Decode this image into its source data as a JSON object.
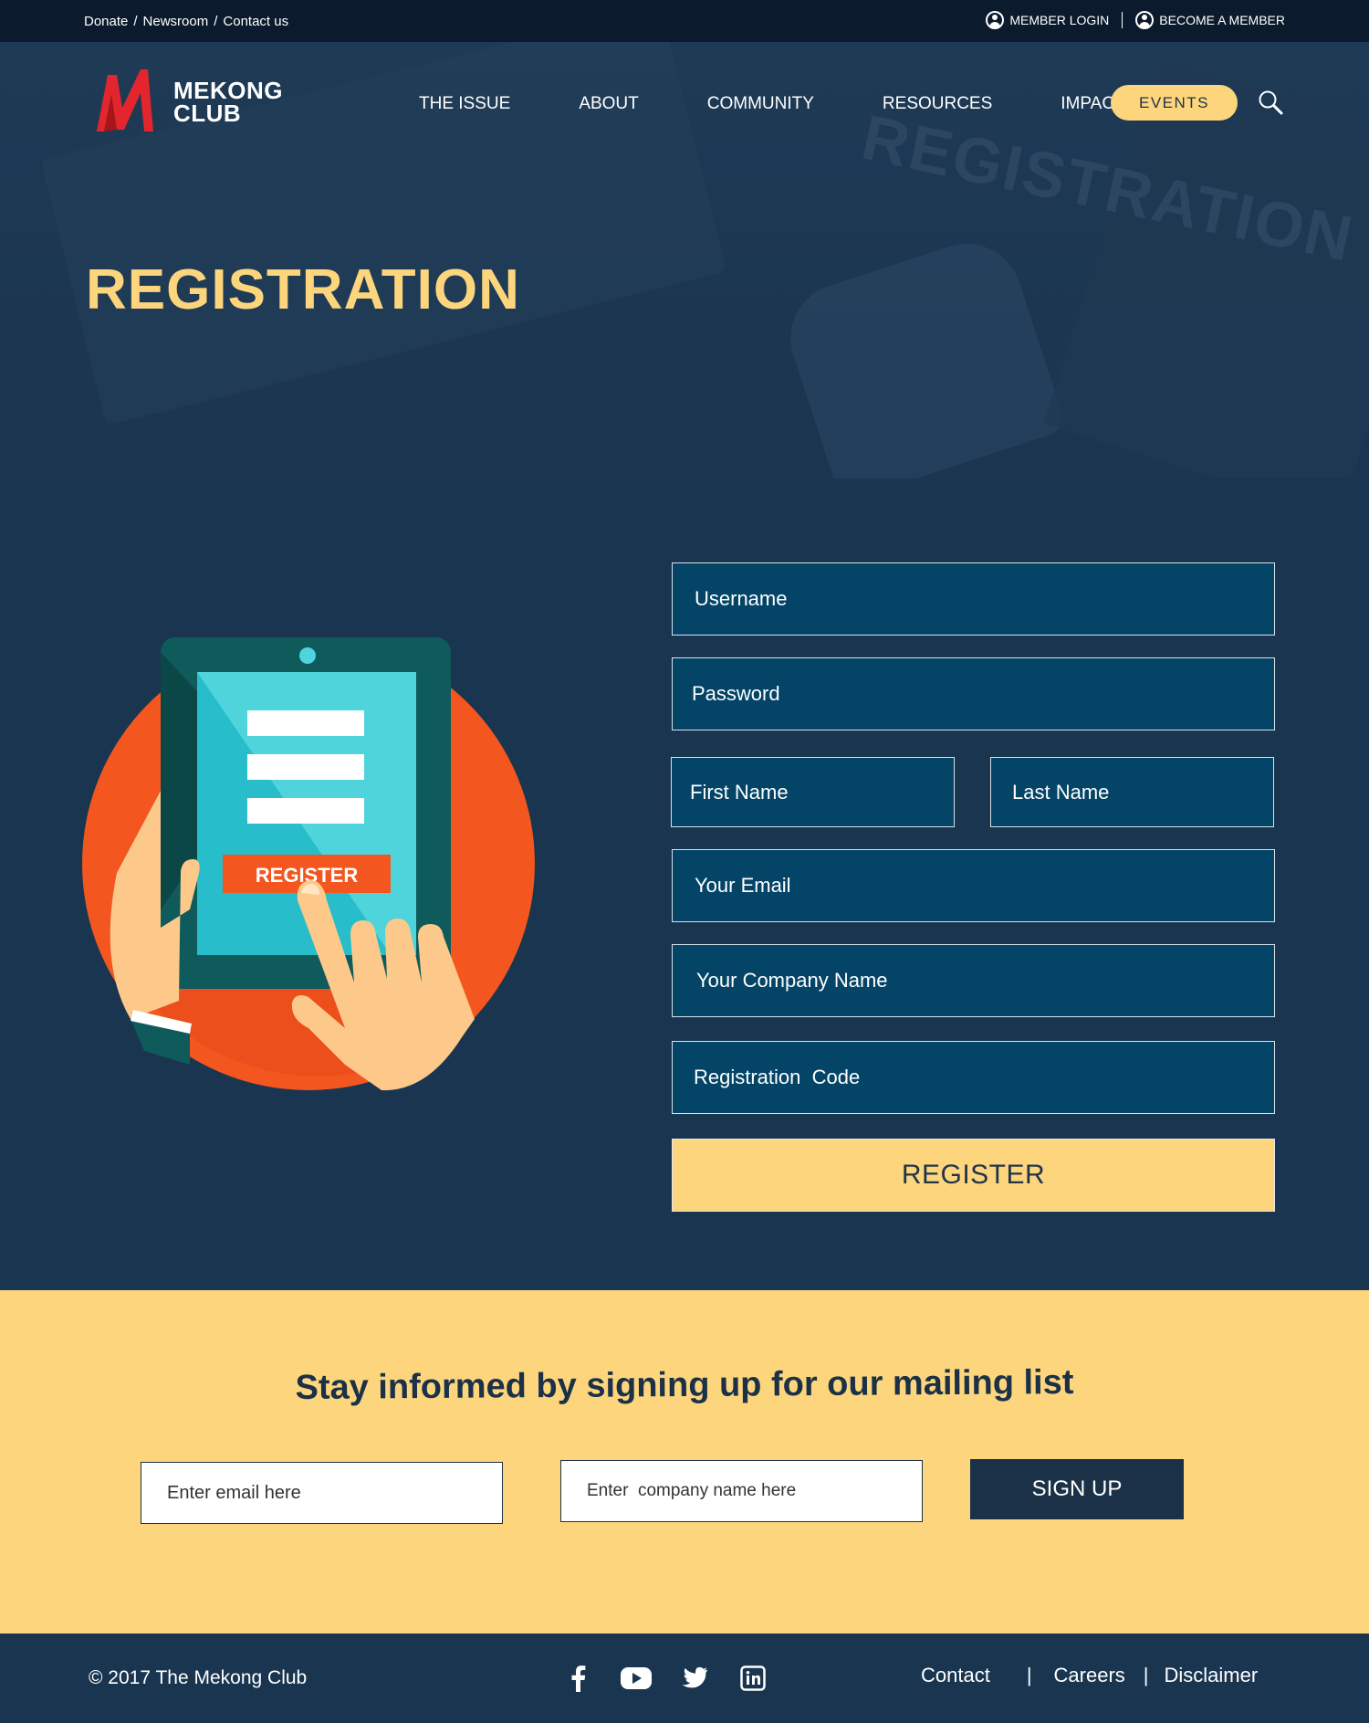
{
  "utility": {
    "left_links": [
      "Donate",
      "Newsroom",
      "Contact us"
    ],
    "separator": "/",
    "member_login": "MEMBER  LOGIN",
    "become_member": "BECOME A MEMBER"
  },
  "brand": {
    "line1": "MEKONG",
    "line2": "CLUB"
  },
  "nav": {
    "items": [
      "THE ISSUE",
      "ABOUT",
      "COMMUNITY",
      "RESOURCES",
      "IMPACT"
    ],
    "events": "EVENTS"
  },
  "hero": {
    "title": "REGISTRATION",
    "ghost_text": "REGISTRATION"
  },
  "illustration": {
    "button_text": "REGISTER"
  },
  "form": {
    "username": "Username",
    "password": "Password",
    "first_name": "First Name",
    "last_name": "Last Name",
    "email": "Your Email",
    "company": "Your Company Name",
    "code": "Registration  Code",
    "submit": "REGISTER"
  },
  "mailing": {
    "heading": "Stay informed by signing up for our mailing list",
    "email_placeholder": "Enter email here",
    "company_placeholder": "Enter  company name here",
    "signup": "SIGN UP"
  },
  "footer": {
    "copyright": "© 2017 The Mekong Club",
    "links": [
      "Contact",
      "Careers",
      "Disclaimer"
    ],
    "separator": "|",
    "social": [
      "facebook-icon",
      "youtube-icon",
      "twitter-icon",
      "linkedin-icon"
    ]
  },
  "colors": {
    "navy": "#1a3550",
    "topbar": "#0b1a2c",
    "field": "#034467",
    "accent_yellow": "#fdd57c",
    "logo_red": "#e3262d",
    "illustration_orange": "#f3561f",
    "tablet_teal": "#0f5a5a",
    "screen_cyan": "#4fd4dc"
  }
}
